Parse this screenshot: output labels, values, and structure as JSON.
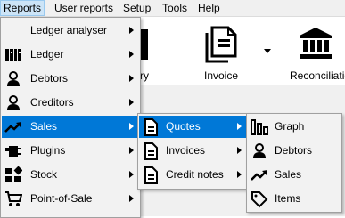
{
  "menubar": {
    "items": [
      "Reports",
      "User reports",
      "Setup",
      "Tools",
      "Help"
    ]
  },
  "toolbar": {
    "entry_label": "ntry",
    "invoice_label": "Invoice",
    "reconciliation_label": "Reconciliation"
  },
  "reports_menu": {
    "items": [
      {
        "label": "Ledger analyser",
        "icon": "none",
        "submenu": true
      },
      {
        "label": "Ledger",
        "icon": "books-icon",
        "submenu": true
      },
      {
        "label": "Debtors",
        "icon": "person-icon",
        "submenu": true
      },
      {
        "label": "Creditors",
        "icon": "person-icon",
        "submenu": true
      },
      {
        "label": "Sales",
        "icon": "trend-icon",
        "submenu": true,
        "highlighted": true
      },
      {
        "label": "Plugins",
        "icon": "plug-icon",
        "submenu": true
      },
      {
        "label": "Stock",
        "icon": "blocks-icon",
        "submenu": true
      },
      {
        "label": "Point-of-Sale",
        "icon": "cart-icon",
        "submenu": true
      }
    ]
  },
  "sales_menu": {
    "items": [
      {
        "label": "Quotes",
        "icon": "document-icon",
        "submenu": true,
        "highlighted": true
      },
      {
        "label": "Invoices",
        "icon": "document-icon",
        "submenu": true
      },
      {
        "label": "Credit notes",
        "icon": "document-icon",
        "submenu": true
      }
    ]
  },
  "quotes_menu": {
    "items": [
      {
        "label": "Graph",
        "icon": "bar-chart-icon"
      },
      {
        "label": "Debtors",
        "icon": "person-icon"
      },
      {
        "label": "Sales",
        "icon": "trend-icon"
      },
      {
        "label": "Items",
        "icon": "tag-icon"
      }
    ]
  },
  "colors": {
    "highlight": "#0078d7",
    "menubar_active": "#cce4f7"
  }
}
